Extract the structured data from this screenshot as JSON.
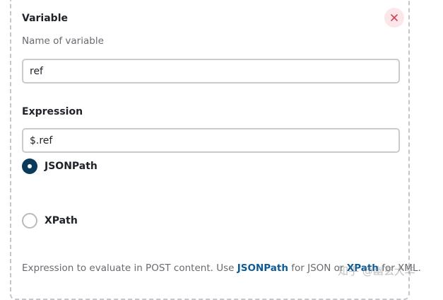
{
  "form": {
    "variable_label": "Variable",
    "variable_hint": "Name of variable",
    "variable_value": "ref",
    "expression_label": "Expression",
    "expression_value": "$.ref",
    "expression_type": {
      "selected": "JSONPath",
      "options": [
        "JSONPath",
        "XPath"
      ]
    },
    "help": {
      "prefix": "Expression to evaluate in POST content. Use ",
      "jsonpath_link": "JSONPath",
      "middle": " for JSON or ",
      "xpath_link": "XPath",
      "suffix": " for XML."
    }
  },
  "icons": {
    "close": "close-icon"
  },
  "colors": {
    "radio_selected": "#0b3a5a",
    "link": "#0e5b93",
    "close_bg": "#fbe7e9",
    "close_icon": "#d0455c"
  },
  "watermark": "知乎 @幽玄大华"
}
